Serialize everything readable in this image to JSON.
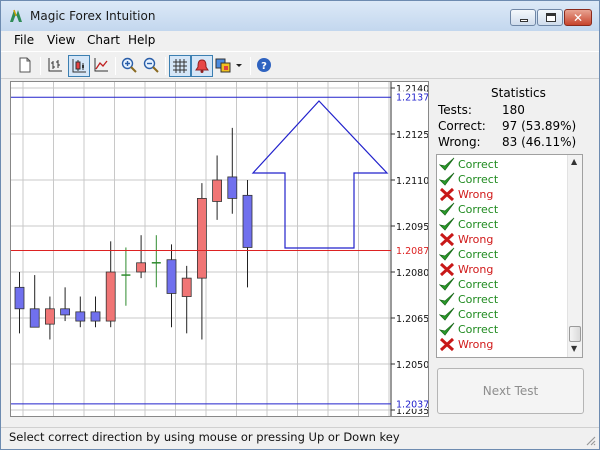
{
  "window": {
    "title": "Magic Forex Intuition"
  },
  "menu": [
    "File",
    "View",
    "Chart",
    "Help"
  ],
  "toolbar": [
    "new-icon",
    "bar-chart-icon",
    "candle-chart-icon",
    "line-chart-icon",
    "zoom-in-icon",
    "zoom-out-icon",
    "grid-icon",
    "alarm-icon",
    "colors-icon",
    "dropdown-icon",
    "help-icon"
  ],
  "statistics": {
    "title": "Statistics",
    "tests_label": "Tests:",
    "tests_value": "180",
    "correct_label": "Correct:",
    "correct_value": "97 (53.89%)",
    "wrong_label": "Wrong:",
    "wrong_value": "83 (46.11%)"
  },
  "results": [
    "Correct",
    "Correct",
    "Wrong",
    "Correct",
    "Correct",
    "Wrong",
    "Correct",
    "Wrong",
    "Correct",
    "Correct",
    "Correct",
    "Correct",
    "Wrong"
  ],
  "next_button": "Next Test",
  "status": "Select correct direction by using mouse or pressing Up or Down key",
  "colors": {
    "bull": "#f07575",
    "bear": "#7070ee",
    "doji": "#2e8b2e",
    "level_blue": "#2222cc",
    "level_red": "#dd2222"
  },
  "chart_data": {
    "type": "candlestick",
    "y_ticks": [
      "1.2140",
      "1.2125",
      "1.2110",
      "1.2095",
      "1.2080",
      "1.2065",
      "1.2050",
      "1.2035"
    ],
    "ylim": [
      1.2035,
      1.214
    ],
    "grid": true,
    "levels": [
      {
        "label": "1.2137",
        "value": 1.2137,
        "color": "blue"
      },
      {
        "label": "1.2087",
        "value": 1.2087,
        "color": "red"
      },
      {
        "label": "1.2037",
        "value": 1.2037,
        "color": "blue"
      }
    ],
    "candles": [
      {
        "o": 1.2075,
        "h": 1.208,
        "l": 1.206,
        "c": 1.2068
      },
      {
        "o": 1.2068,
        "h": 1.2079,
        "l": 1.2062,
        "c": 1.2062
      },
      {
        "o": 1.2063,
        "h": 1.2072,
        "l": 1.2058,
        "c": 1.2068
      },
      {
        "o": 1.2068,
        "h": 1.2075,
        "l": 1.2064,
        "c": 1.2066
      },
      {
        "o": 1.2067,
        "h": 1.2072,
        "l": 1.2062,
        "c": 1.2064
      },
      {
        "o": 1.2067,
        "h": 1.2072,
        "l": 1.2062,
        "c": 1.2064
      },
      {
        "o": 1.2064,
        "h": 1.209,
        "l": 1.2062,
        "c": 1.208
      },
      {
        "o": 1.2079,
        "h": 1.2088,
        "l": 1.2069,
        "c": 1.2079
      },
      {
        "o": 1.208,
        "h": 1.2092,
        "l": 1.2078,
        "c": 1.2083
      },
      {
        "o": 1.2083,
        "h": 1.2092,
        "l": 1.2075,
        "c": 1.2084
      },
      {
        "o": 1.2084,
        "h": 1.2089,
        "l": 1.2062,
        "c": 1.2073
      },
      {
        "o": 1.2072,
        "h": 1.2082,
        "l": 1.206,
        "c": 1.2078
      },
      {
        "o": 1.2078,
        "h": 1.2109,
        "l": 1.2058,
        "c": 1.2104
      },
      {
        "o": 1.2103,
        "h": 1.2118,
        "l": 1.2097,
        "c": 1.211
      },
      {
        "o": 1.2111,
        "h": 1.2127,
        "l": 1.2099,
        "c": 1.2104
      },
      {
        "o": 1.2105,
        "h": 1.211,
        "l": 1.2075,
        "c": 1.2088
      }
    ]
  }
}
